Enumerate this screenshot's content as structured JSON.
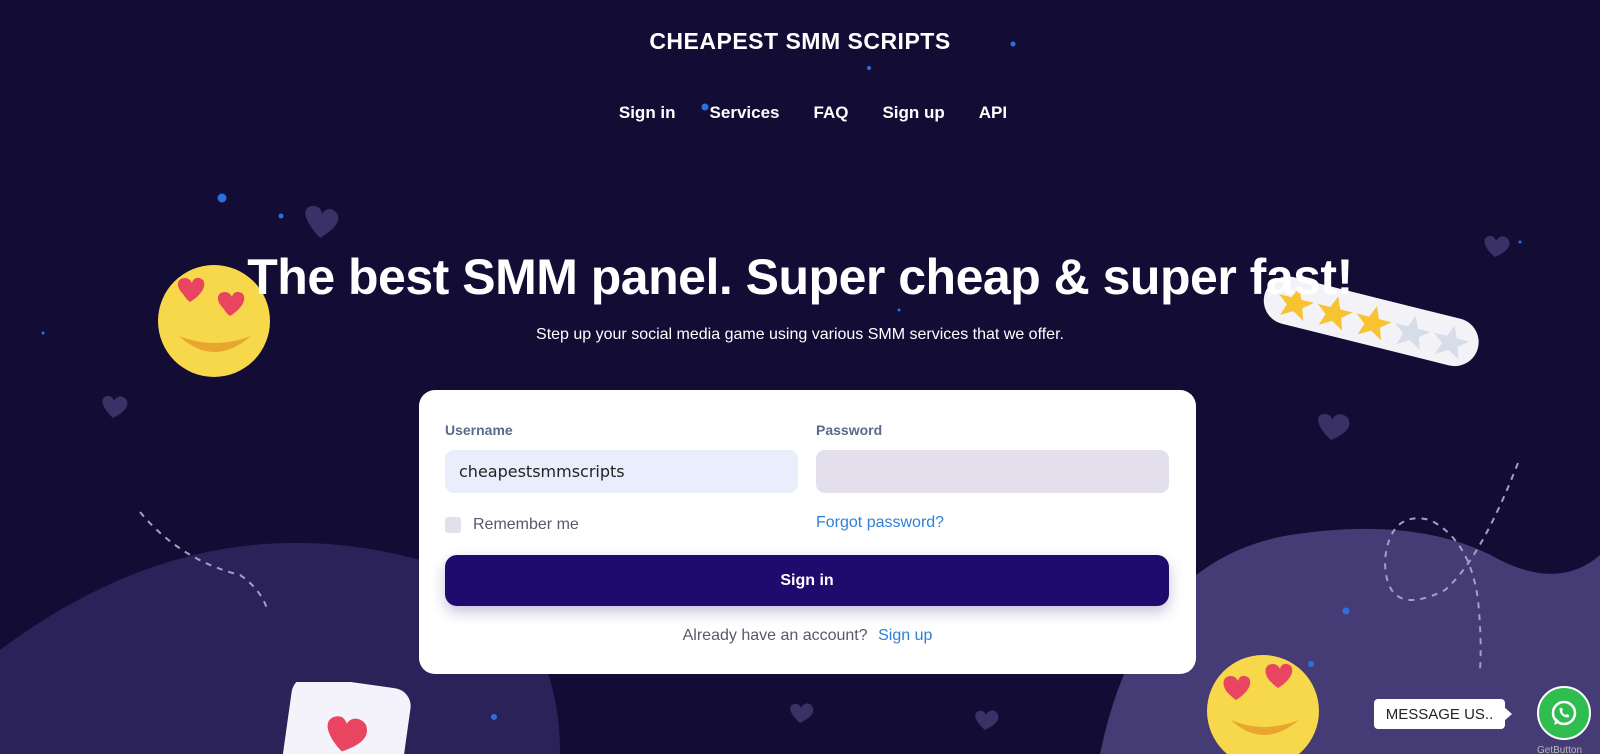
{
  "brand": {
    "title": "CHEAPEST SMM SCRIPTS"
  },
  "nav": {
    "items": [
      "Sign in",
      "Services",
      "FAQ",
      "Sign up",
      "API"
    ]
  },
  "hero": {
    "title": "The best SMM panel. Super cheap & super fast!",
    "subtitle": "Step up your social media game using various SMM services that we offer."
  },
  "login": {
    "username_label": "Username",
    "username_value": "cheapestsmmscripts",
    "password_label": "Password",
    "password_value": "",
    "remember_label": "Remember me",
    "forgot_label": "Forgot password?",
    "signin_label": "Sign in",
    "no_account_text": "Already have an account?",
    "signup_link": "Sign up"
  },
  "widget": {
    "message_label": "MESSAGE US..",
    "getbutton_label": "GetButton",
    "icon": "whatsapp-icon"
  },
  "decor": {
    "rating_stars": 3,
    "rating_max": 5,
    "icons": [
      "heart-eyes-emoji",
      "star-rating-badge",
      "heart-card",
      "heart-icon"
    ]
  },
  "colors": {
    "background": "#130c35",
    "primary_button": "#1f0b6e",
    "link": "#2f7fd8",
    "whatsapp": "#2ebd4e",
    "accent_dot": "#2e6fe0"
  }
}
